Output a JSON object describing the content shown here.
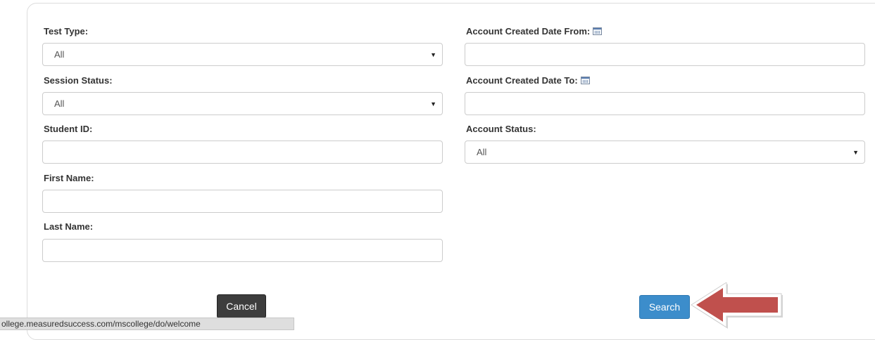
{
  "form": {
    "test_type": {
      "label": "Test Type:",
      "value": "All"
    },
    "session_status": {
      "label": "Session Status:",
      "value": "All"
    },
    "student_id": {
      "label": "Student ID:",
      "value": ""
    },
    "first_name": {
      "label": "First Name:",
      "value": ""
    },
    "last_name": {
      "label": "Last Name:",
      "value": ""
    },
    "created_from": {
      "label": "Account Created Date From:",
      "value": "",
      "icon": "calendar-icon"
    },
    "created_to": {
      "label": "Account Created Date To:",
      "value": "",
      "icon": "calendar-icon"
    },
    "account_status": {
      "label": "Account Status:",
      "value": "All"
    }
  },
  "buttons": {
    "cancel": "Cancel",
    "search": "Search"
  },
  "status_bar": {
    "url": "ollege.measuredsuccess.com/mscollege/do/welcome"
  },
  "colors": {
    "search_button": "#3c8dcb",
    "cancel_button": "#3d3d3d",
    "arrow": "#c0504d"
  }
}
